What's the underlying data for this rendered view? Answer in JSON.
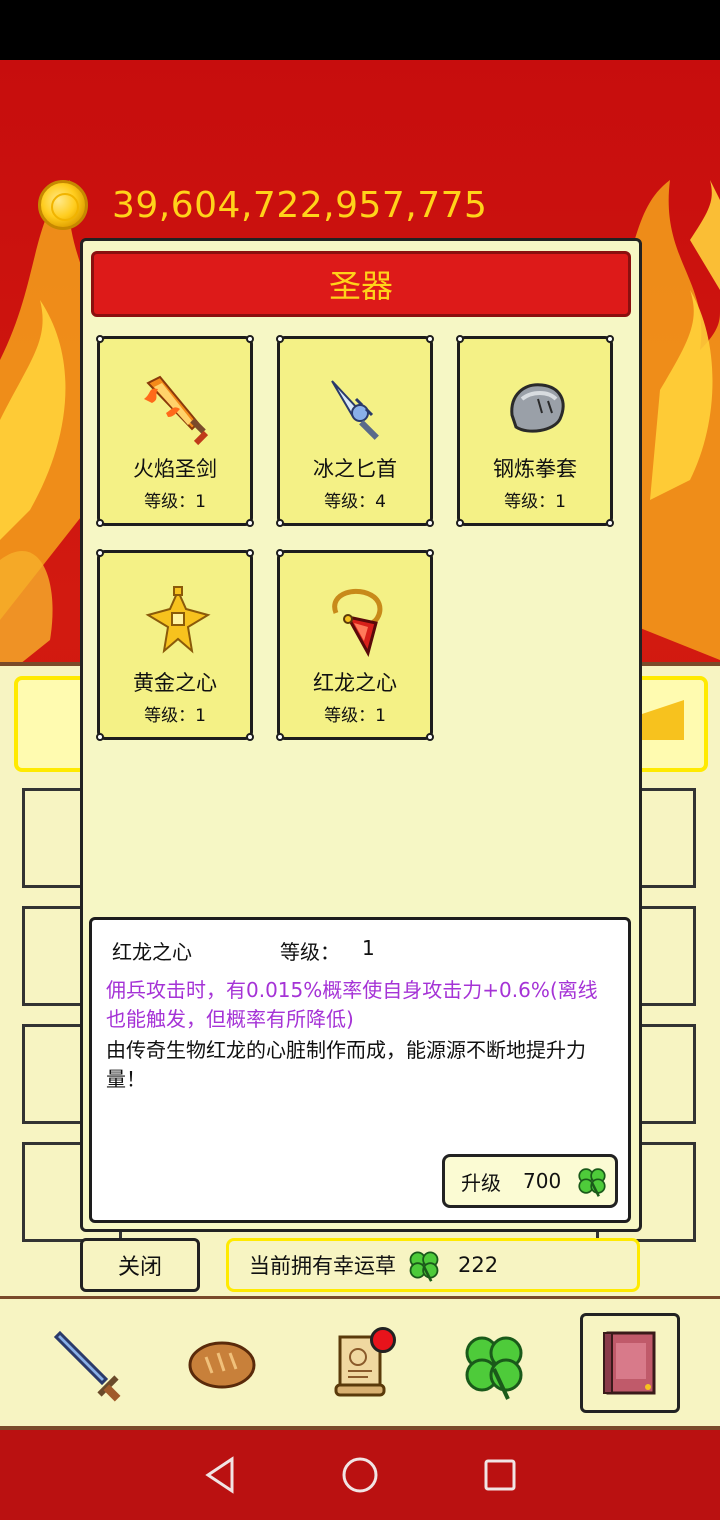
{
  "gold": {
    "amount": "39,604,722,957,775"
  },
  "modal": {
    "title": "圣器",
    "relics": [
      {
        "name": "火焰圣剑",
        "level": "等级：1",
        "icon": "flame-sword-icon"
      },
      {
        "name": "冰之匕首",
        "level": "等级：4",
        "icon": "ice-dagger-icon"
      },
      {
        "name": "钢炼拳套",
        "level": "等级：1",
        "icon": "steel-gauntlet-icon"
      },
      {
        "name": "黄金之心",
        "level": "等级：1",
        "icon": "golden-heart-icon"
      },
      {
        "name": "红龙之心",
        "level": "等级：1",
        "icon": "red-dragon-heart-icon"
      }
    ],
    "detail": {
      "name": "红龙之心",
      "level_label": "等级：",
      "level_value": "1",
      "effect": "佣兵攻击时，有0.015%概率使自身攻击力+0.6%(离线也能触发，但概率有所降低)",
      "description": "由传奇生物红龙的心脏制作而成，能源源不断地提升力量！",
      "upgrade_label": "升级",
      "upgrade_cost": "700"
    }
  },
  "footer": {
    "close_label": "关闭",
    "clover_label": "当前拥有幸运草",
    "clover_count": "222"
  },
  "nav": {
    "items": [
      "sword-icon",
      "bread-icon",
      "scroll-icon",
      "clover-icon",
      "book-icon"
    ],
    "active": "book-icon"
  },
  "colors": {
    "background_red": "#c70d0d",
    "gold_text": "#ffd31a",
    "panel_yellow": "#f6f7c5",
    "card_yellow": "#f4f186",
    "effect_purple": "#a533d6"
  }
}
